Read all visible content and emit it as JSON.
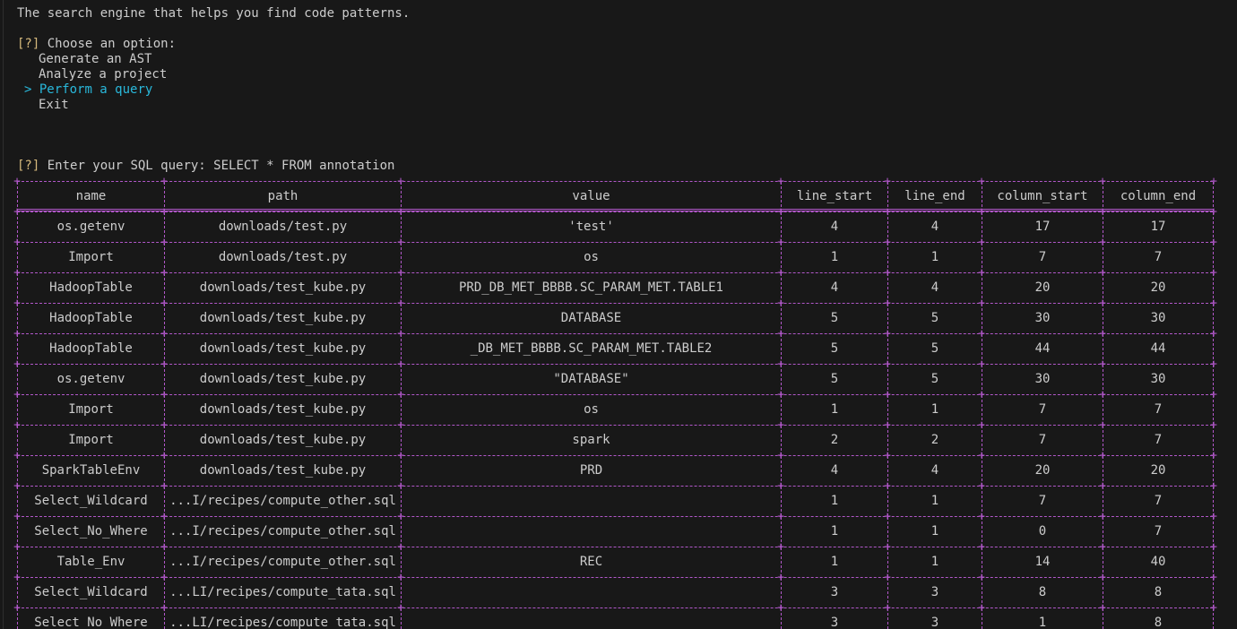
{
  "intro": {
    "tagline": "The search engine that helps you find code patterns."
  },
  "menu": {
    "prompt_marker": "[?]",
    "prompt_text": " Choose an option:",
    "options": [
      {
        "label": "Generate an AST",
        "selected": false
      },
      {
        "label": "Analyze a project",
        "selected": false
      },
      {
        "label": "Perform a query",
        "selected": true
      },
      {
        "label": "Exit",
        "selected": false
      }
    ],
    "cursor": ">"
  },
  "query": {
    "prompt_marker": "[?]",
    "prompt_text": " Enter your SQL query: SELECT * FROM annotation"
  },
  "table": {
    "columns": [
      "name",
      "path",
      "value",
      "line_start",
      "line_end",
      "column_start",
      "column_end"
    ],
    "rows": [
      [
        "os.getenv",
        "downloads/test.py",
        "'test'",
        "4",
        "4",
        "17",
        "17"
      ],
      [
        "Import",
        "downloads/test.py",
        "os",
        "1",
        "1",
        "7",
        "7"
      ],
      [
        "HadoopTable",
        "downloads/test_kube.py",
        "PRD_DB_MET_BBBB.SC_PARAM_MET.TABLE1",
        "4",
        "4",
        "20",
        "20"
      ],
      [
        "HadoopTable",
        "downloads/test_kube.py",
        "DATABASE",
        "5",
        "5",
        "30",
        "30"
      ],
      [
        "HadoopTable",
        "downloads/test_kube.py",
        "_DB_MET_BBBB.SC_PARAM_MET.TABLE2",
        "5",
        "5",
        "44",
        "44"
      ],
      [
        "os.getenv",
        "downloads/test_kube.py",
        "\"DATABASE\"",
        "5",
        "5",
        "30",
        "30"
      ],
      [
        "Import",
        "downloads/test_kube.py",
        "os",
        "1",
        "1",
        "7",
        "7"
      ],
      [
        "Import",
        "downloads/test_kube.py",
        "spark",
        "2",
        "2",
        "7",
        "7"
      ],
      [
        "SparkTableEnv",
        "downloads/test_kube.py",
        "PRD",
        "4",
        "4",
        "20",
        "20"
      ],
      [
        "Select_Wildcard",
        "...I/recipes/compute_other.sql",
        "",
        "1",
        "1",
        "7",
        "7"
      ],
      [
        "Select_No_Where",
        "...I/recipes/compute_other.sql",
        "",
        "1",
        "1",
        "0",
        "7"
      ],
      [
        "Table_Env",
        "...I/recipes/compute_other.sql",
        "REC",
        "1",
        "1",
        "14",
        "40"
      ],
      [
        "Select_Wildcard",
        "...LI/recipes/compute_tata.sql",
        "",
        "3",
        "3",
        "8",
        "8"
      ],
      [
        "Select_No_Where",
        "...LI/recipes/compute_tata.sql",
        "",
        "3",
        "3",
        "1",
        "8"
      ]
    ]
  },
  "colors": {
    "background": "#181818",
    "text": "#cccccc",
    "prompt_marker": "#d7ba7d",
    "selected_option": "#29b8db",
    "table_border": "#b157c9"
  }
}
